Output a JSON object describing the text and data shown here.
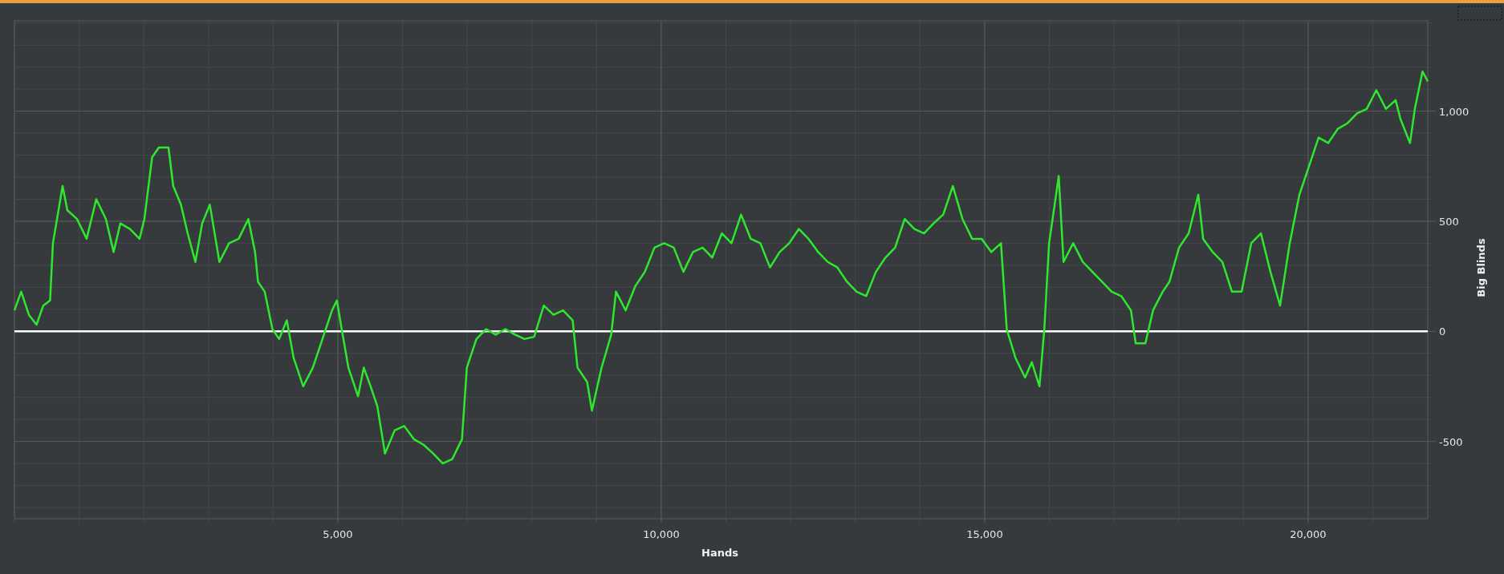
{
  "chart_data": {
    "type": "line",
    "xlabel": "Hands",
    "ylabel": "Big Blinds",
    "xlim": [
      0,
      21850
    ],
    "ylim": [
      -851,
      1410
    ],
    "xticks": [
      {
        "value": 5000,
        "label": "5,000"
      },
      {
        "value": 10000,
        "label": "10,000"
      },
      {
        "value": 15000,
        "label": "15,000"
      },
      {
        "value": 20000,
        "label": "20,000"
      }
    ],
    "yticks": [
      {
        "value": -500,
        "label": "-500"
      },
      {
        "value": 0,
        "label": "0"
      },
      {
        "value": 500,
        "label": "500"
      },
      {
        "value": 1000,
        "label": "1,000"
      }
    ],
    "x": [
      0,
      104,
      223,
      342,
      446,
      551,
      595,
      670,
      744,
      818,
      967,
      1116,
      1265,
      1414,
      1533,
      1637,
      1786,
      1934,
      2009,
      2128,
      2232,
      2381,
      2455,
      2574,
      2678,
      2797,
      2902,
      3021,
      3169,
      3318,
      3467,
      3616,
      3720,
      3765,
      3869,
      3988,
      4092,
      4211,
      4315,
      4464,
      4613,
      4762,
      4910,
      4985,
      5059,
      5163,
      5312,
      5401,
      5506,
      5610,
      5729,
      5878,
      6026,
      6175,
      6324,
      6473,
      6622,
      6770,
      6919,
      6994,
      7142,
      7291,
      7440,
      7589,
      7738,
      7886,
      8035,
      8184,
      8333,
      8482,
      8630,
      8705,
      8854,
      8928,
      9077,
      9226,
      9300,
      9449,
      9598,
      9746,
      9895,
      10044,
      10193,
      10342,
      10490,
      10639,
      10788,
      10937,
      11086,
      11234,
      11383,
      11532,
      11681,
      11830,
      11978,
      12127,
      12276,
      12425,
      12574,
      12722,
      12871,
      13020,
      13169,
      13318,
      13466,
      13615,
      13764,
      13913,
      14062,
      14210,
      14359,
      14508,
      14657,
      14806,
      14954,
      15103,
      15252,
      15341,
      15475,
      15624,
      15728,
      15847,
      15922,
      15996,
      16145,
      16219,
      16368,
      16517,
      16666,
      16814,
      16963,
      17112,
      17261,
      17335,
      17484,
      17603,
      17752,
      17856,
      18005,
      18154,
      18302,
      18377,
      18526,
      18674,
      18823,
      18972,
      19121,
      19270,
      19418,
      19567,
      19716,
      19865,
      20014,
      20162,
      20311,
      20460,
      20609,
      20758,
      20906,
      21055,
      21204,
      21353,
      21427,
      21576,
      21650,
      21769,
      21850
    ],
    "series": [
      {
        "color": "#2ee82e",
        "values": [
          95,
          180,
          75,
          30,
          117,
          140,
          400,
          530,
          660,
          550,
          510,
          420,
          600,
          510,
          360,
          490,
          465,
          420,
          510,
          790,
          835,
          835,
          660,
          575,
          445,
          315,
          490,
          575,
          315,
          400,
          420,
          510,
          360,
          225,
          180,
          10,
          -35,
          50,
          -120,
          -250,
          -165,
          -35,
          95,
          140,
          10,
          -165,
          -295,
          -165,
          -250,
          -340,
          -555,
          -450,
          -430,
          -490,
          -515,
          -555,
          -600,
          -580,
          -490,
          -165,
          -35,
          10,
          -15,
          10,
          -15,
          -35,
          -25,
          117,
          75,
          95,
          50,
          -165,
          -230,
          -360,
          -165,
          -15,
          180,
          95,
          205,
          270,
          380,
          400,
          380,
          270,
          360,
          380,
          335,
          445,
          400,
          530,
          420,
          400,
          290,
          360,
          400,
          465,
          420,
          360,
          315,
          290,
          225,
          180,
          160,
          270,
          335,
          380,
          510,
          465,
          445,
          490,
          530,
          660,
          510,
          420,
          420,
          360,
          400,
          10,
          -120,
          -210,
          -140,
          -250,
          10,
          400,
          705,
          315,
          400,
          315,
          270,
          225,
          180,
          160,
          95,
          -55,
          -55,
          95,
          180,
          225,
          380,
          445,
          620,
          420,
          360,
          315,
          180,
          180,
          400,
          445,
          270,
          117,
          400,
          620,
          750,
          880,
          855,
          920,
          945,
          990,
          1010,
          1095,
          1010,
          1050,
          965,
          855,
          1010,
          1180,
          1135
        ]
      }
    ],
    "grid": true,
    "ref_lines": [
      {
        "axis": "y",
        "value": 0
      }
    ]
  }
}
